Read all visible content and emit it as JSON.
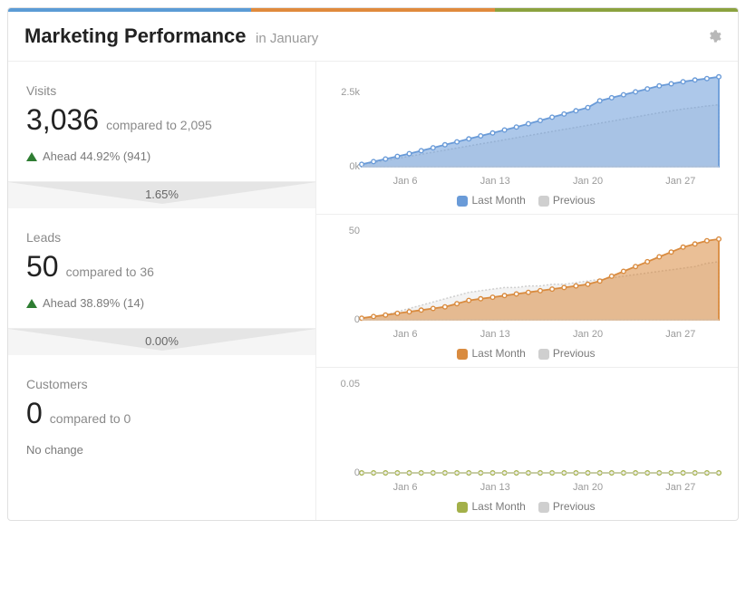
{
  "header": {
    "title": "Marketing Performance",
    "subtitle": "in January"
  },
  "accent_colors": {
    "visits": "#6a9bd8",
    "leads": "#d98b3f",
    "customers": "#a3b049",
    "previous": "#cfcfcf"
  },
  "metrics": {
    "visits": {
      "label": "Visits",
      "value": "3,036",
      "compared_label": "compared to",
      "compared_to": "2,095",
      "change_text": "Ahead 44.92% (941)",
      "change_dir": "up"
    },
    "leads": {
      "label": "Leads",
      "value": "50",
      "compared_label": "compared to",
      "compared_to": "36",
      "change_text": "Ahead 38.89% (14)",
      "change_dir": "up"
    },
    "customers": {
      "label": "Customers",
      "value": "0",
      "compared_label": "compared to",
      "compared_to": "0",
      "change_text": "No change",
      "change_dir": "none"
    }
  },
  "funnel": {
    "visits_to_leads": "1.65%",
    "leads_to_customers": "0.00%"
  },
  "legend": {
    "current": "Last Month",
    "previous": "Previous"
  },
  "xticks": [
    "Jan 6",
    "Jan 13",
    "Jan 20",
    "Jan 27"
  ],
  "chart_data": [
    {
      "type": "area",
      "title": "Visits",
      "xlabel": "",
      "ylabel": "",
      "ylim": [
        0,
        3000
      ],
      "yticks": [
        "0k",
        "2.5k"
      ],
      "categories": [
        "Jan 1",
        "Jan 2",
        "Jan 3",
        "Jan 4",
        "Jan 5",
        "Jan 6",
        "Jan 7",
        "Jan 8",
        "Jan 9",
        "Jan 10",
        "Jan 11",
        "Jan 12",
        "Jan 13",
        "Jan 14",
        "Jan 15",
        "Jan 16",
        "Jan 17",
        "Jan 18",
        "Jan 19",
        "Jan 20",
        "Jan 21",
        "Jan 22",
        "Jan 23",
        "Jan 24",
        "Jan 25",
        "Jan 26",
        "Jan 27",
        "Jan 28",
        "Jan 29",
        "Jan 30",
        "Jan 31"
      ],
      "series": [
        {
          "name": "Last Month",
          "values": [
            80,
            170,
            260,
            350,
            440,
            540,
            640,
            740,
            840,
            940,
            1040,
            1140,
            1240,
            1340,
            1450,
            1560,
            1670,
            1780,
            1890,
            2000,
            2230,
            2330,
            2430,
            2530,
            2630,
            2730,
            2800,
            2870,
            2930,
            2980,
            3036
          ]
        },
        {
          "name": "Previous",
          "values": [
            70,
            140,
            210,
            280,
            350,
            420,
            490,
            560,
            630,
            700,
            770,
            840,
            910,
            980,
            1050,
            1120,
            1190,
            1260,
            1330,
            1400,
            1470,
            1540,
            1610,
            1680,
            1750,
            1820,
            1890,
            1950,
            2000,
            2050,
            2095
          ]
        }
      ]
    },
    {
      "type": "area",
      "title": "Leads",
      "xlabel": "",
      "ylabel": "",
      "ylim": [
        0,
        55
      ],
      "yticks": [
        "0",
        "50"
      ],
      "categories": [
        "Jan 1",
        "Jan 2",
        "Jan 3",
        "Jan 4",
        "Jan 5",
        "Jan 6",
        "Jan 7",
        "Jan 8",
        "Jan 9",
        "Jan 10",
        "Jan 11",
        "Jan 12",
        "Jan 13",
        "Jan 14",
        "Jan 15",
        "Jan 16",
        "Jan 17",
        "Jan 18",
        "Jan 19",
        "Jan 20",
        "Jan 21",
        "Jan 22",
        "Jan 23",
        "Jan 24",
        "Jan 25",
        "Jan 26",
        "Jan 27",
        "Jan 28",
        "Jan 29",
        "Jan 30",
        "Jan 31"
      ],
      "series": [
        {
          "name": "Last Month",
          "values": [
            1,
            2,
            3,
            4,
            5,
            6,
            7,
            8,
            10,
            12,
            13,
            14,
            15,
            16,
            17,
            18,
            19,
            20,
            21,
            22,
            24,
            27,
            30,
            33,
            36,
            39,
            42,
            45,
            47,
            49,
            50
          ]
        },
        {
          "name": "Previous",
          "values": [
            1,
            2,
            3,
            5,
            7,
            9,
            11,
            13,
            15,
            17,
            18,
            19,
            20,
            20,
            21,
            21,
            22,
            22,
            23,
            24,
            25,
            26,
            27,
            28,
            29,
            30,
            31,
            32,
            33,
            35,
            36
          ]
        }
      ]
    },
    {
      "type": "area",
      "title": "Customers",
      "xlabel": "",
      "ylabel": "",
      "ylim": [
        0,
        0.05
      ],
      "yticks": [
        "0",
        "0.05"
      ],
      "categories": [
        "Jan 1",
        "Jan 2",
        "Jan 3",
        "Jan 4",
        "Jan 5",
        "Jan 6",
        "Jan 7",
        "Jan 8",
        "Jan 9",
        "Jan 10",
        "Jan 11",
        "Jan 12",
        "Jan 13",
        "Jan 14",
        "Jan 15",
        "Jan 16",
        "Jan 17",
        "Jan 18",
        "Jan 19",
        "Jan 20",
        "Jan 21",
        "Jan 22",
        "Jan 23",
        "Jan 24",
        "Jan 25",
        "Jan 26",
        "Jan 27",
        "Jan 28",
        "Jan 29",
        "Jan 30",
        "Jan 31"
      ],
      "series": [
        {
          "name": "Last Month",
          "values": [
            0,
            0,
            0,
            0,
            0,
            0,
            0,
            0,
            0,
            0,
            0,
            0,
            0,
            0,
            0,
            0,
            0,
            0,
            0,
            0,
            0,
            0,
            0,
            0,
            0,
            0,
            0,
            0,
            0,
            0,
            0
          ]
        },
        {
          "name": "Previous",
          "values": [
            0,
            0,
            0,
            0,
            0,
            0,
            0,
            0,
            0,
            0,
            0,
            0,
            0,
            0,
            0,
            0,
            0,
            0,
            0,
            0,
            0,
            0,
            0,
            0,
            0,
            0,
            0,
            0,
            0,
            0,
            0
          ]
        }
      ]
    }
  ]
}
